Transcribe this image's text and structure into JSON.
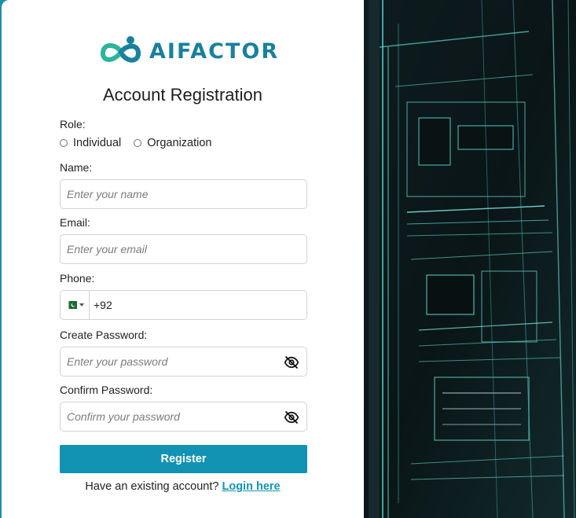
{
  "brand": {
    "name": "AIFACTOR"
  },
  "page": {
    "title": "Account Registration"
  },
  "form": {
    "role_label": "Role:",
    "roles": [
      "Individual",
      "Organization"
    ],
    "name_label": "Name:",
    "name_placeholder": "Enter your name",
    "email_label": "Email:",
    "email_placeholder": "Enter your email",
    "phone_label": "Phone:",
    "phone_code": "+92",
    "create_password_label": "Create Password:",
    "create_password_placeholder": "Enter your password",
    "confirm_password_label": "Confirm Password:",
    "confirm_password_placeholder": "Confirm your password",
    "register_label": "Register"
  },
  "footer": {
    "prompt": "Have an existing account?",
    "login_label": "Login here"
  },
  "icons": {
    "logo": "infinity-person-logo-icon",
    "flag": "pakistan-flag-icon",
    "dropdown": "caret-down-icon",
    "password_toggle": "eye-slash-icon"
  },
  "colors": {
    "accent": "#1293b3",
    "logo": "#1b7f9e",
    "logo_green": "#2bb59a",
    "background": "#1d8fa8",
    "circuit": "#5fd6d0"
  }
}
